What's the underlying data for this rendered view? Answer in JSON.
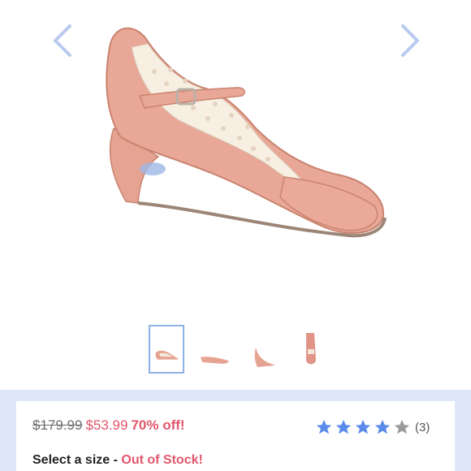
{
  "gallery": {
    "prev_icon": "chevron-left-icon",
    "next_icon": "chevron-right-icon",
    "thumbnail_count": 4,
    "selected_thumbnail": 1
  },
  "product": {
    "original_price": "$179.99",
    "sale_price": "$53.99",
    "discount": "70% off!",
    "rating": 4,
    "rating_max": 5,
    "review_count": "(3)"
  },
  "size": {
    "label": "Select a size",
    "separator": " - ",
    "status": "Out of Stock!"
  },
  "colors": {
    "accent": "#8fb0e6",
    "sale": "#e2566b",
    "star_filled": "#5b8bea",
    "star_empty": "#9a9a9a",
    "band": "#dfe8f8"
  }
}
